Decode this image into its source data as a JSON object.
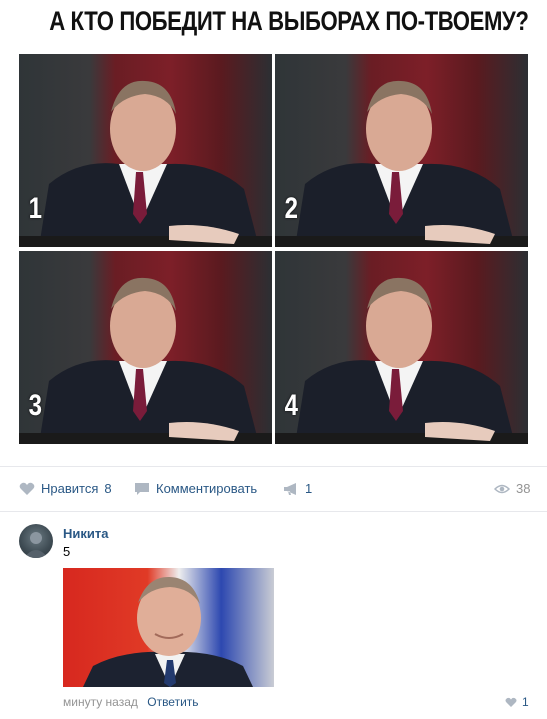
{
  "post": {
    "title": "А КТО ПОБЕДИТ НА ВЫБОРАХ ПО-ТВОЕМУ?",
    "tiles": [
      {
        "label": "1"
      },
      {
        "label": "2"
      },
      {
        "label": "3"
      },
      {
        "label": "4"
      }
    ]
  },
  "actions": {
    "like_label": "Нравится",
    "like_count": "8",
    "comment_label": "Комментировать",
    "share_count": "1",
    "views_count": "38"
  },
  "comment": {
    "author": "Никита",
    "text": "5",
    "time": "минуту назад",
    "reply_label": "Ответить",
    "like_count": "1"
  },
  "colors": {
    "link": "#2a5885",
    "muted": "#939393",
    "icon": "#aeb7c2",
    "divider": "#e7e8ec"
  },
  "icons": [
    "heart-icon",
    "comment-icon",
    "megaphone-icon",
    "eye-icon"
  ]
}
